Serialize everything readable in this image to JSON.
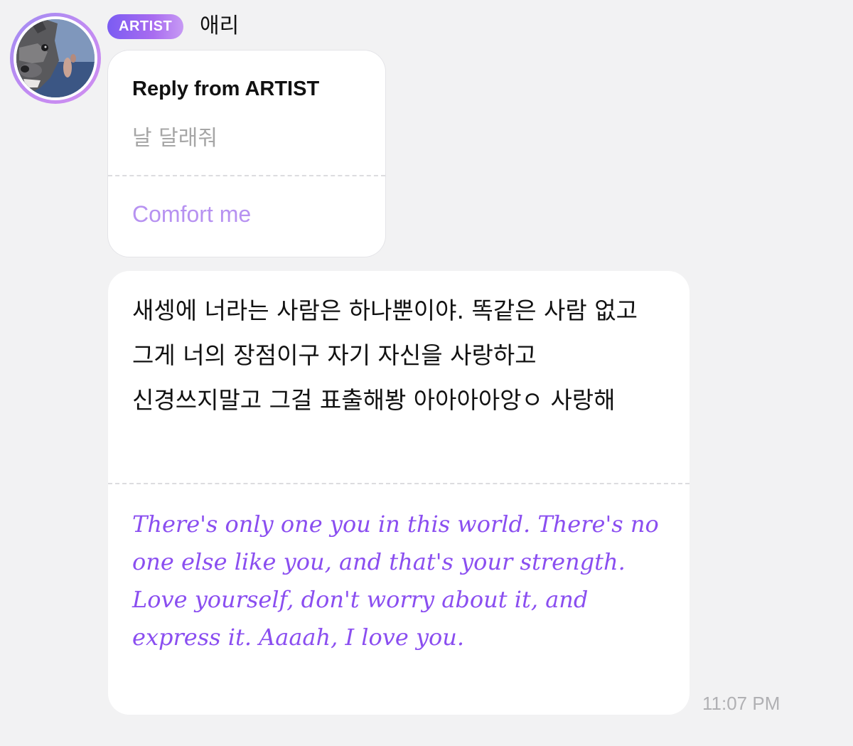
{
  "header": {
    "badge_label": "ARTIST",
    "username": "애리"
  },
  "avatar": {
    "icon": "profile-photo",
    "ring_color": "#b38cf2"
  },
  "reply": {
    "title": "Reply from ARTIST",
    "original_text": "날 달래줘",
    "translated_text": "Comfort me"
  },
  "message": {
    "original_text": "새셍에 너라는 사람은 하나뿐이야. 똑같은 사람 없고 그게 너의 장점이구 자기 자신을 사랑하고 신경쓰지말고 그걸 표출해봥 아아아아앙ㅇ 사랑해",
    "translated_text": "There's only one you in this world. There's no one else like you, and that's your strength. Love yourself, don't worry about it, and express it. Aaaah, I love you."
  },
  "timestamp": "11:07 PM",
  "colors": {
    "accent": "#8a4ef0",
    "accent_light": "#b792f1",
    "background": "#f2f2f3",
    "card": "#ffffff",
    "muted_text": "#a6a6a6"
  }
}
